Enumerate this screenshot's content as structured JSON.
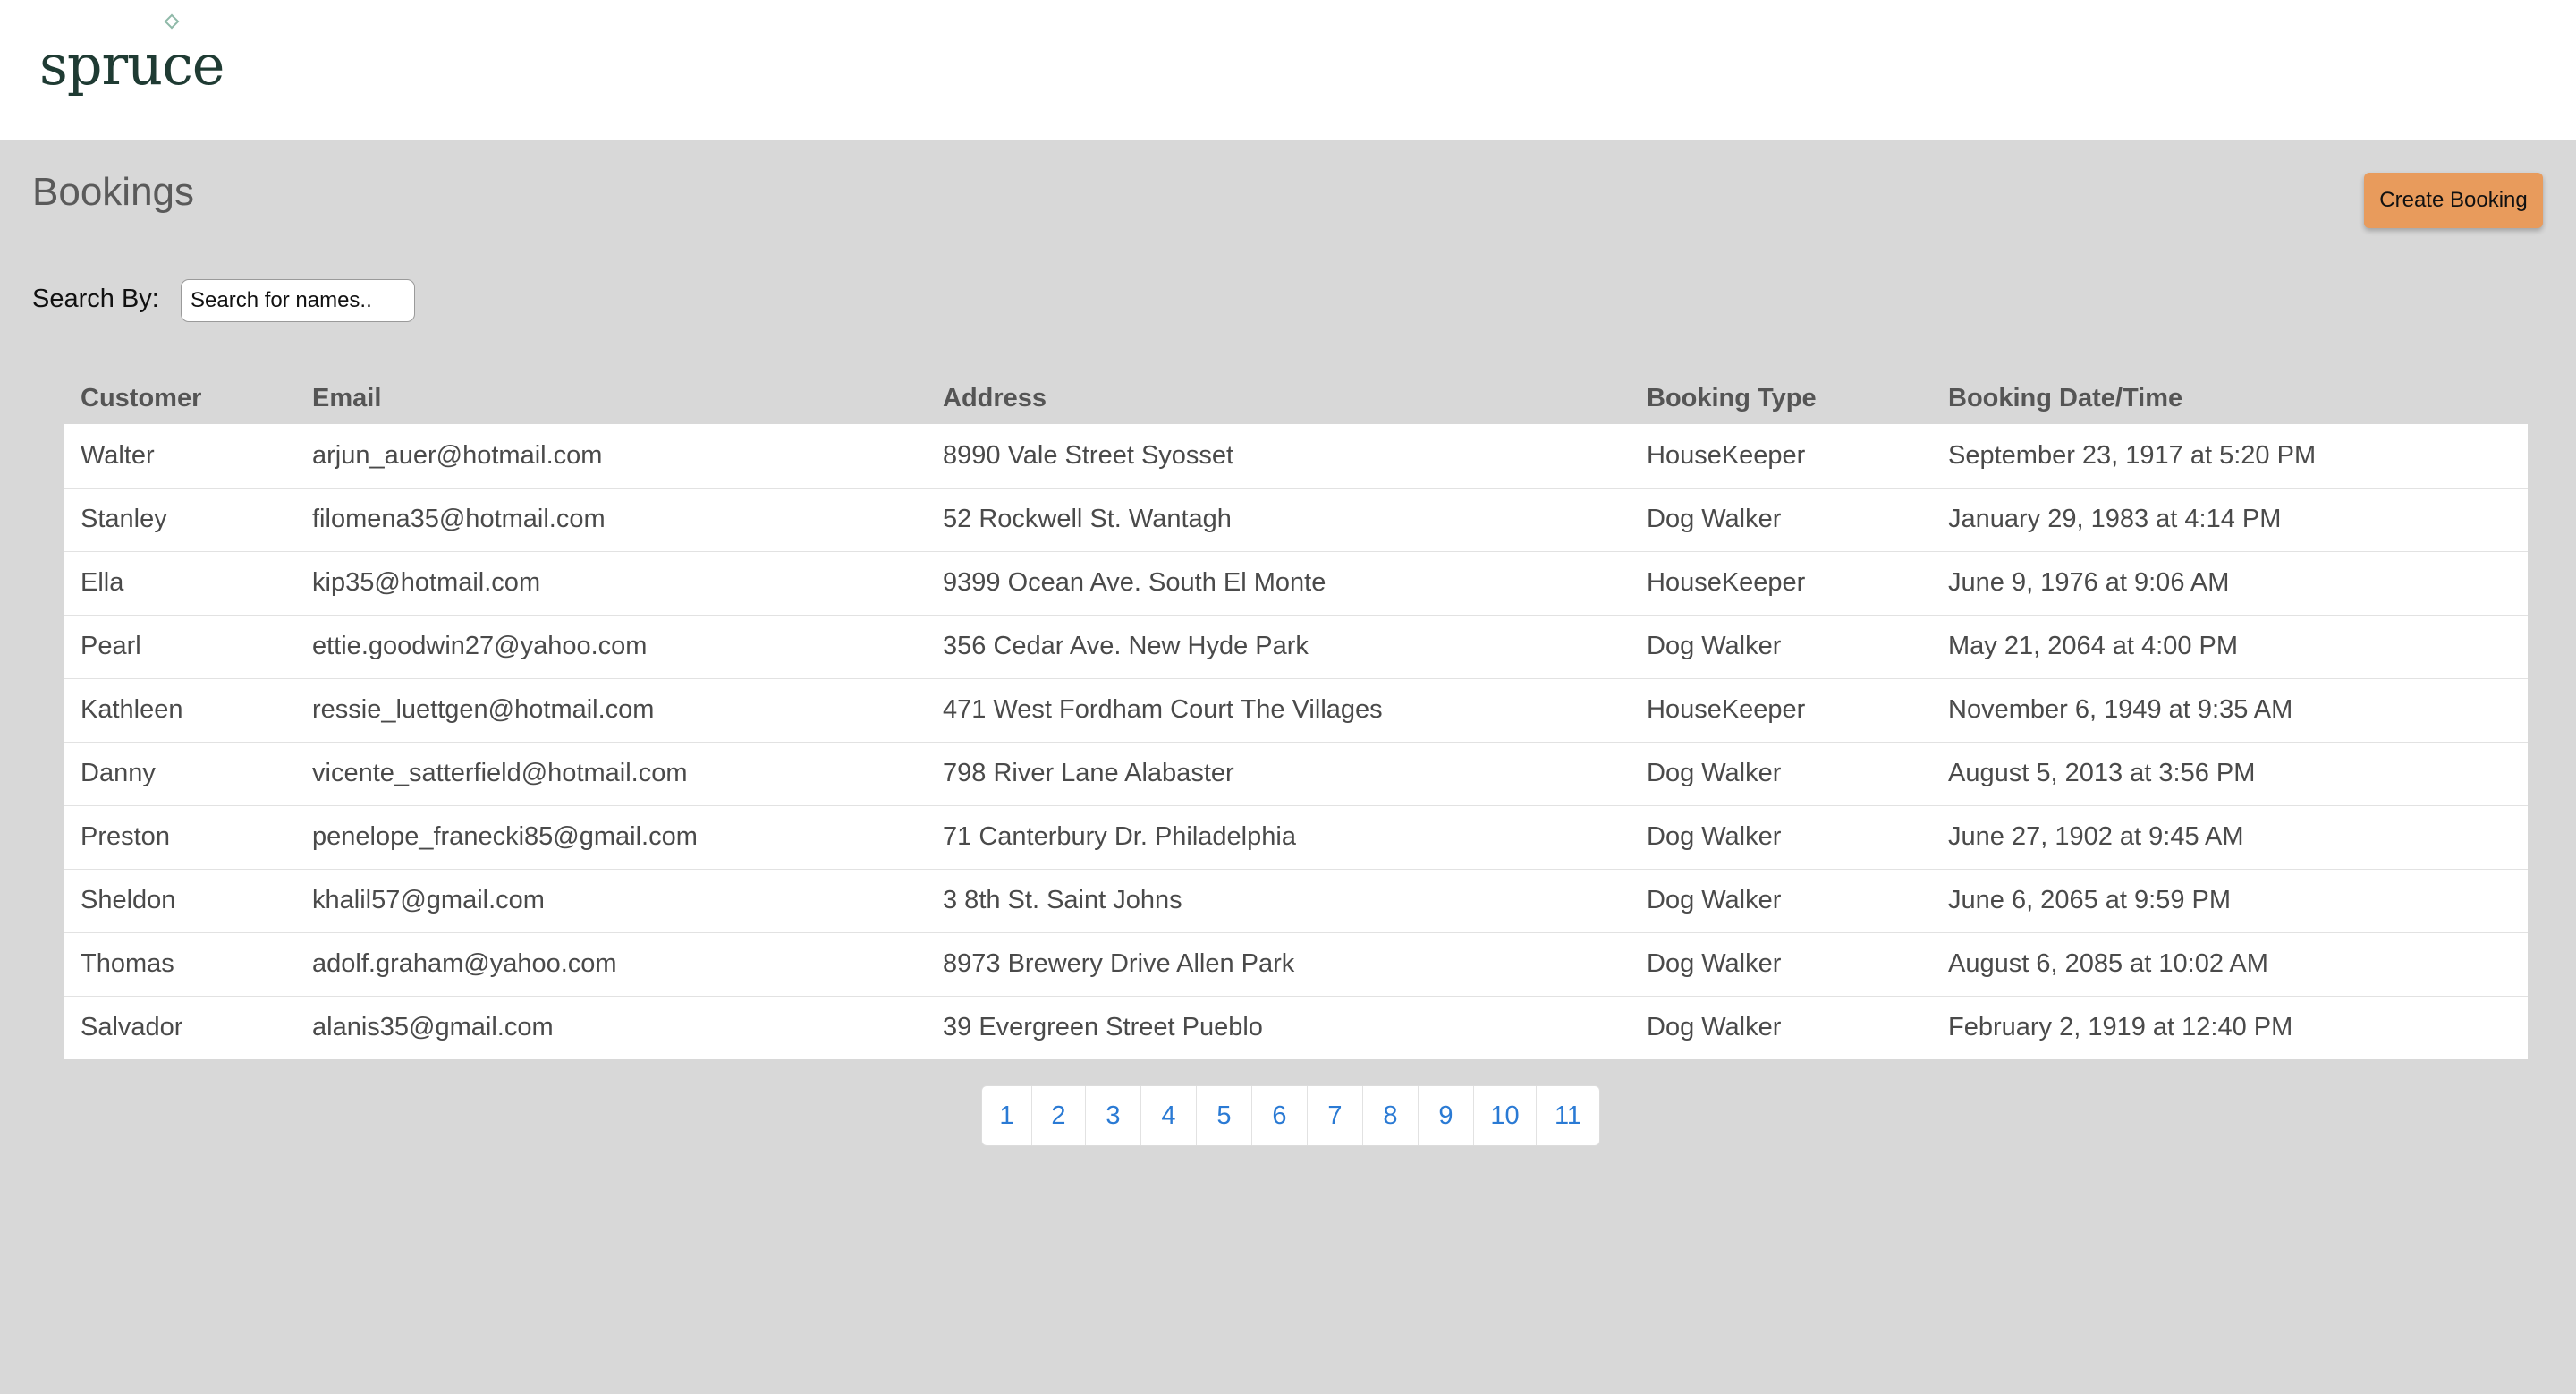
{
  "header": {
    "logo_text": "spruce"
  },
  "page": {
    "title": "Bookings",
    "create_button_label": "Create Booking"
  },
  "search": {
    "label": "Search By:",
    "placeholder": "Search for names..",
    "value": ""
  },
  "table": {
    "columns": [
      "Customer",
      "Email",
      "Address",
      "Booking Type",
      "Booking Date/Time"
    ],
    "rows": [
      [
        "Walter",
        "arjun_auer@hotmail.com",
        "8990 Vale Street Syosset",
        "HouseKeeper",
        "September 23, 1917 at 5:20 PM"
      ],
      [
        "Stanley",
        "filomena35@hotmail.com",
        "52 Rockwell St. Wantagh",
        "Dog Walker",
        "January 29, 1983 at 4:14 PM"
      ],
      [
        "Ella",
        "kip35@hotmail.com",
        "9399 Ocean Ave. South El Monte",
        "HouseKeeper",
        "June 9, 1976 at 9:06 AM"
      ],
      [
        "Pearl",
        "ettie.goodwin27@yahoo.com",
        "356 Cedar Ave. New Hyde Park",
        "Dog Walker",
        "May 21, 2064 at 4:00 PM"
      ],
      [
        "Kathleen",
        "ressie_luettgen@hotmail.com",
        "471 West Fordham Court The Villages",
        "HouseKeeper",
        "November 6, 1949 at 9:35 AM"
      ],
      [
        "Danny",
        "vicente_satterfield@hotmail.com",
        "798 River Lane Alabaster",
        "Dog Walker",
        "August 5, 2013 at 3:56 PM"
      ],
      [
        "Preston",
        "penelope_franecki85@gmail.com",
        "71 Canterbury Dr. Philadelphia",
        "Dog Walker",
        "June 27, 1902 at 9:45 AM"
      ],
      [
        "Sheldon",
        "khalil57@gmail.com",
        "3 8th St. Saint Johns",
        "Dog Walker",
        "June 6, 2065 at 9:59 PM"
      ],
      [
        "Thomas",
        "adolf.graham@yahoo.com",
        "8973 Brewery Drive Allen Park",
        "Dog Walker",
        "August 6, 2085 at 10:02 AM"
      ],
      [
        "Salvador",
        "alanis35@gmail.com",
        "39 Evergreen Street Pueblo",
        "Dog Walker",
        "February 2, 1919 at 12:40 PM"
      ]
    ]
  },
  "pagination": {
    "pages": [
      "1",
      "2",
      "3",
      "4",
      "5",
      "6",
      "7",
      "8",
      "9",
      "10",
      "11"
    ]
  },
  "colors": {
    "accent_button": "#e89b5c",
    "page_background": "#d8d8d8",
    "link": "#2a7ad4",
    "logo": "#1f3b33"
  }
}
